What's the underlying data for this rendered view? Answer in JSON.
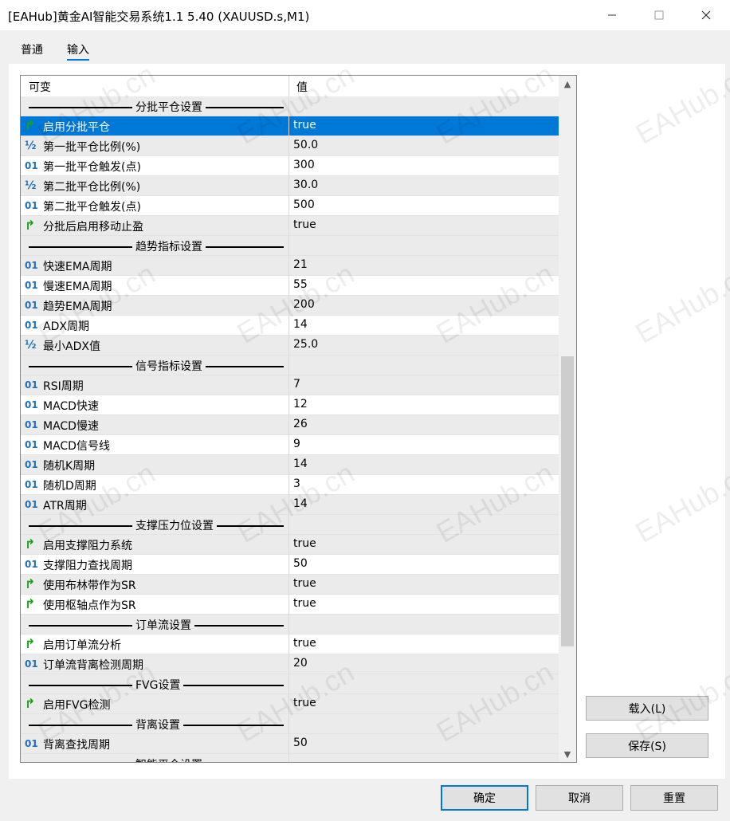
{
  "window": {
    "title": "[EAHub]黄金AI智能交易系统1.1 5.40 (XAUUSD.s,M1)",
    "min_icon": "minimize-icon",
    "max_icon": "maximize-icon",
    "close_icon": "close-icon"
  },
  "tabs": [
    {
      "label": "普通",
      "active": false
    },
    {
      "label": "输入",
      "active": true
    }
  ],
  "grid": {
    "headers": {
      "name": "可变",
      "value": "值"
    },
    "rows": [
      {
        "type": "section",
        "name": "分批平仓设置"
      },
      {
        "type": "bool",
        "name": "启用分批平仓",
        "value": "true",
        "selected": true
      },
      {
        "type": "double",
        "name": "第一批平仓比例(%)",
        "value": "50.0"
      },
      {
        "type": "int",
        "name": "第一批平仓触发(点)",
        "value": "300"
      },
      {
        "type": "double",
        "name": "第二批平仓比例(%)",
        "value": "30.0"
      },
      {
        "type": "int",
        "name": "第二批平仓触发(点)",
        "value": "500"
      },
      {
        "type": "bool",
        "name": "分批后启用移动止盈",
        "value": "true"
      },
      {
        "type": "section",
        "name": "趋势指标设置"
      },
      {
        "type": "int",
        "name": "快速EMA周期",
        "value": "21"
      },
      {
        "type": "int",
        "name": "慢速EMA周期",
        "value": "55"
      },
      {
        "type": "int",
        "name": "趋势EMA周期",
        "value": "200"
      },
      {
        "type": "int",
        "name": "ADX周期",
        "value": "14"
      },
      {
        "type": "double",
        "name": "最小ADX值",
        "value": "25.0"
      },
      {
        "type": "section",
        "name": "信号指标设置"
      },
      {
        "type": "int",
        "name": "RSI周期",
        "value": "7"
      },
      {
        "type": "int",
        "name": "MACD快速",
        "value": "12"
      },
      {
        "type": "int",
        "name": "MACD慢速",
        "value": "26"
      },
      {
        "type": "int",
        "name": "MACD信号线",
        "value": "9"
      },
      {
        "type": "int",
        "name": "随机K周期",
        "value": "14"
      },
      {
        "type": "int",
        "name": "随机D周期",
        "value": "3"
      },
      {
        "type": "int",
        "name": "ATR周期",
        "value": "14"
      },
      {
        "type": "section",
        "name": "支撑压力位设置"
      },
      {
        "type": "bool",
        "name": "启用支撑阻力系统",
        "value": "true"
      },
      {
        "type": "int",
        "name": "支撑阻力查找周期",
        "value": "50"
      },
      {
        "type": "bool",
        "name": "使用布林带作为SR",
        "value": "true"
      },
      {
        "type": "bool",
        "name": "使用枢轴点作为SR",
        "value": "true"
      },
      {
        "type": "section",
        "name": "订单流设置"
      },
      {
        "type": "bool",
        "name": "启用订单流分析",
        "value": "true"
      },
      {
        "type": "int",
        "name": "订单流背离检测周期",
        "value": "20"
      },
      {
        "type": "section",
        "name": "FVG设置"
      },
      {
        "type": "bool",
        "name": "启用FVG检测",
        "value": "true"
      },
      {
        "type": "section",
        "name": "背离设置"
      },
      {
        "type": "int",
        "name": "背离查找周期",
        "value": "50"
      },
      {
        "type": "section",
        "name": "智能平仓设置"
      }
    ]
  },
  "icons": {
    "int": "01",
    "double": "½",
    "bool": "↱"
  },
  "section_ellipsis": "...",
  "buttons": {
    "load": "载入(L)",
    "save": "保存(S)",
    "ok": "确定",
    "cancel": "取消",
    "reset": "重置"
  },
  "watermark": "EAHub.cn",
  "colors": {
    "selection": "#0078d7",
    "bool_icon": "#19a319",
    "num_icon": "#1f6fbf"
  }
}
